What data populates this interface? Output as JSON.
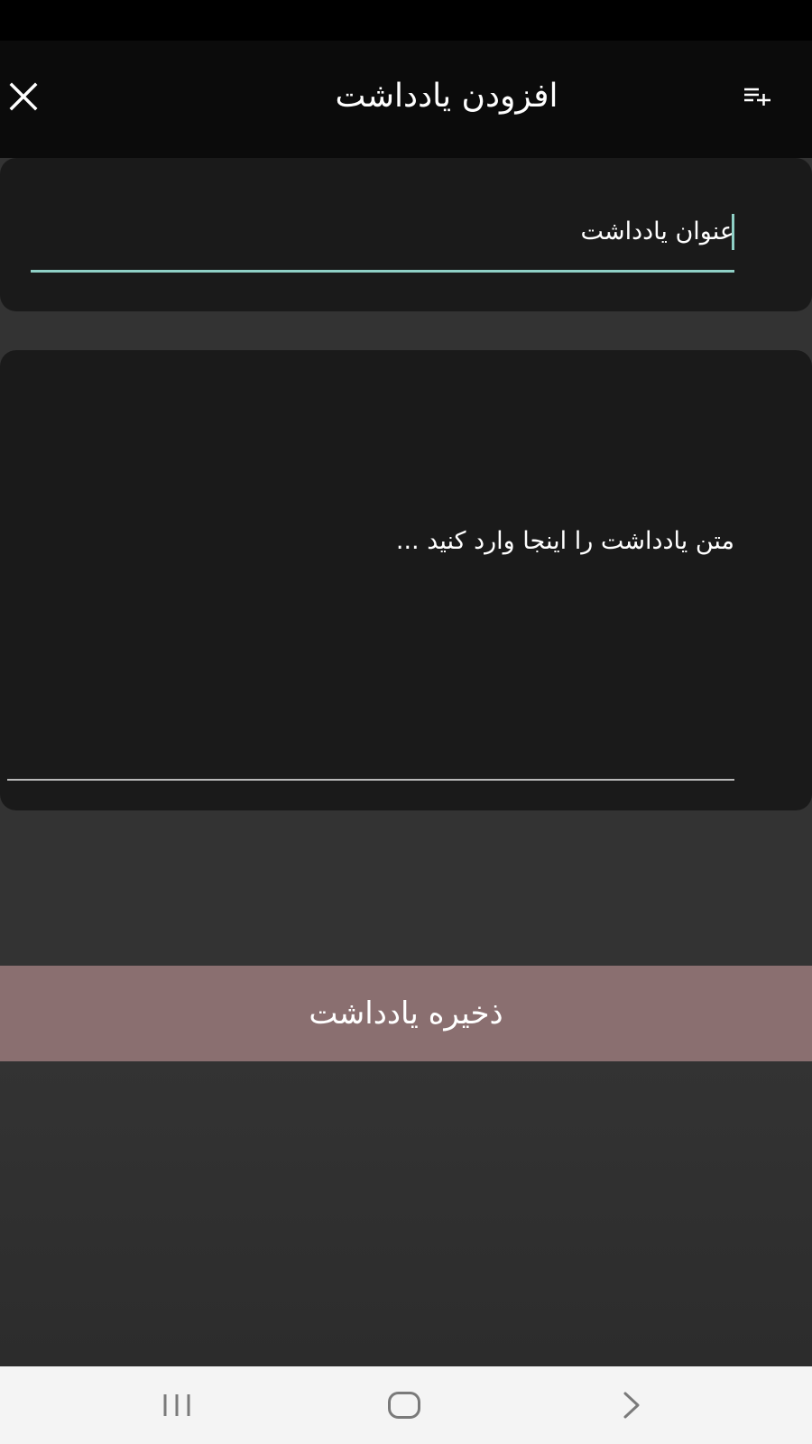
{
  "app_bar": {
    "title": "افزودن یادداشت",
    "close_icon": "close-icon",
    "add_icon": "playlist-add-icon"
  },
  "form": {
    "title_field": {
      "placeholder": "عنوان یادداشت",
      "accent_color": "#8fd0c6"
    },
    "body_field": {
      "placeholder": "متن یادداشت را اینجا وارد کنید ..."
    }
  },
  "save_button": {
    "label": "ذخیره یادداشت",
    "color": "#8a6f70"
  },
  "nav_bar": {
    "recents_icon": "recents-icon",
    "home_icon": "home-icon",
    "back_icon": "back-icon"
  }
}
